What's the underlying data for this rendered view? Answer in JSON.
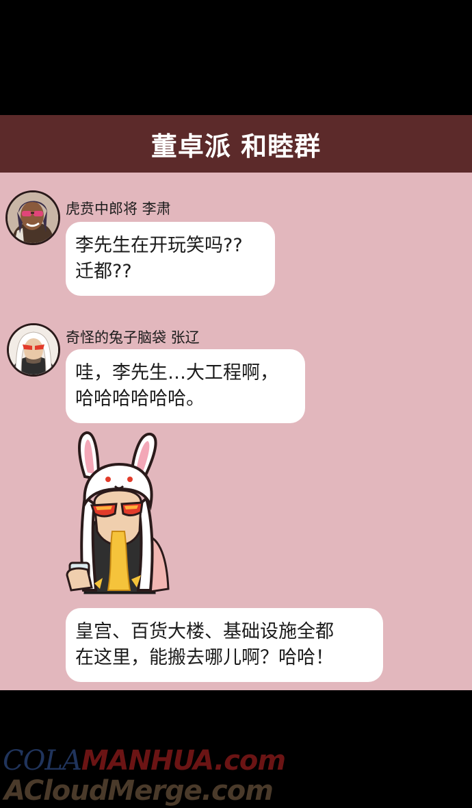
{
  "group_title": "董卓派 和睦群",
  "messages": [
    {
      "sender": "虎贲中郎将 李肃",
      "lines": [
        "李先生在开玩笑吗??",
        "迁都??"
      ]
    },
    {
      "sender": "奇怪的兔子脑袋 张辽",
      "lines": [
        "哇，李先生…大工程啊，",
        "哈哈哈哈哈哈。"
      ]
    },
    {
      "sender": "",
      "lines": [
        "皇宫、百货大楼、基础设施全都",
        "在这里，能搬去哪儿啊？哈哈！"
      ]
    }
  ],
  "watermark": {
    "line1_part1": "COLA",
    "line1_part2": "MANHUA.com",
    "line2": "ACloudMerge.com"
  },
  "colors": {
    "header_bg": "#5c2a2a",
    "chat_bg": "#e2b7bd",
    "bubble_bg": "#ffffff",
    "page_bg": "#000000"
  },
  "icons": {
    "avatar1": "man-with-pink-sunglasses-avatar",
    "avatar2": "rabbit-hood-man-avatar",
    "sticker": "rabbit-hood-man-spitting-drink-sticker"
  }
}
